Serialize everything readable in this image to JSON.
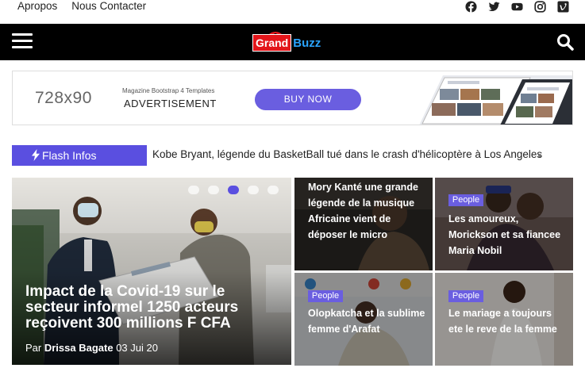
{
  "topbar": {
    "links": [
      "Apropos",
      "Nous Contacter"
    ],
    "social_icons": [
      "facebook-icon",
      "twitter-icon",
      "youtube-icon",
      "instagram-icon",
      "vimeo-icon"
    ]
  },
  "nav": {
    "logo_left": "Grand",
    "logo_right": "Buzz",
    "menu_icon": "hamburger-icon",
    "search_icon": "search-icon"
  },
  "ad": {
    "size_text": "728x90",
    "subtitle": "Magazine Bootstrap 4 Templates",
    "title": "ADVERTISEMENT",
    "button": "BUY NOW"
  },
  "flash": {
    "label": "Flash Infos",
    "headline": "Kobe Bryant, légende du BasketBall tué dans le crash d'hélicoptère à Los Angeles"
  },
  "feature": {
    "title": "Impact de la Covid-19 sur le secteur informel 1250 acteurs reçoivent 300 millions F CFA",
    "by": "Par",
    "author": "Drissa Bagate",
    "date": "03 Jui 20",
    "carousel_active_index": 2,
    "carousel_count": 5
  },
  "cards": [
    {
      "badge": "",
      "title": "Mory Kanté une grande légende de la musique Africaine vient de déposer le micro"
    },
    {
      "badge": "People",
      "title": "Les amoureux, Morickson et sa fiancee Maria Nobil"
    },
    {
      "badge": "People",
      "title": "Olopkatcha et la sublime femme d'Arafat"
    },
    {
      "badge": "People",
      "title": "Le mariage a toujours ete le reve de la femme"
    }
  ],
  "colors": {
    "accent": "#5a4fe0",
    "logo_red": "#e3151a",
    "logo_blue": "#2aa4ff",
    "navbar": "#000000"
  }
}
